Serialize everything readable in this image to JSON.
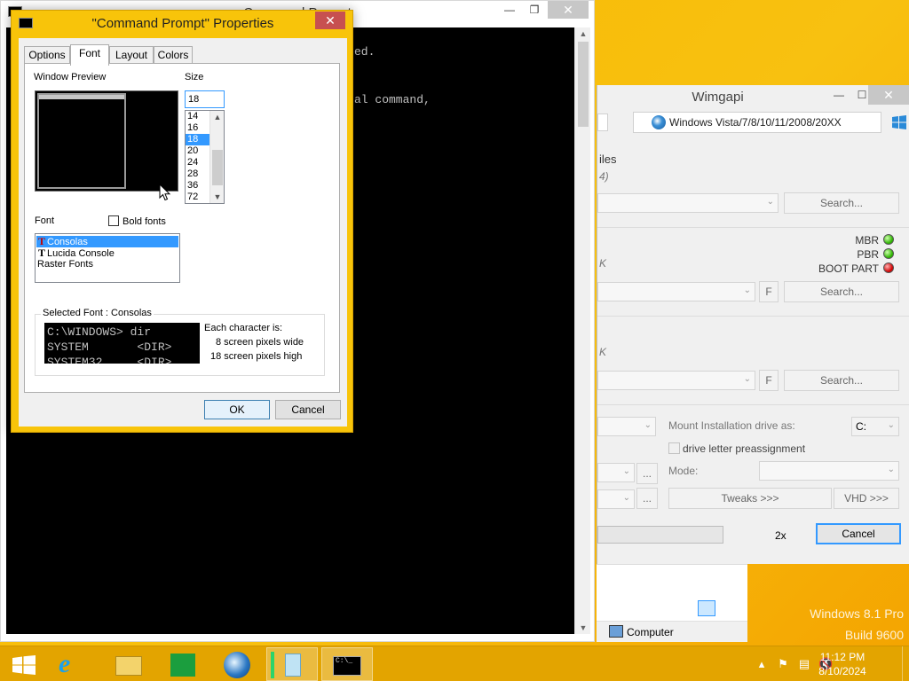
{
  "desktop": {
    "watermark_line1": "Windows 8.1 Pro",
    "watermark_line2": "Build 9600"
  },
  "console": {
    "title": "Command Prompt",
    "minimize": "—",
    "maximize": "❐",
    "close": "✕",
    "lines": [
      "ed.",
      "al command,"
    ]
  },
  "dialog": {
    "title": "\"Command Prompt\" Properties",
    "close": "✕",
    "tabs": [
      "Options",
      "Font",
      "Layout",
      "Colors"
    ],
    "active_tab": "Font",
    "window_preview_label": "Window Preview",
    "size_label": "Size",
    "size_value": "18",
    "sizes": [
      "14",
      "16",
      "18",
      "20",
      "24",
      "28",
      "36",
      "72"
    ],
    "selected_size": "18",
    "font_label": "Font",
    "bold_fonts_label": "Bold fonts",
    "bold_checked": false,
    "fonts": [
      {
        "name": "Consolas",
        "truetype": true,
        "selected": true
      },
      {
        "name": "Lucida Console",
        "truetype": true,
        "selected": false
      },
      {
        "name": "Raster Fonts",
        "truetype": false,
        "selected": false
      }
    ],
    "selected_font_label": "Selected Font : Consolas",
    "sample_lines": [
      "C:\\WINDOWS> dir",
      "SYSTEM       <DIR>",
      "SYSTEM32     <DIR>"
    ],
    "char_info_title": "Each character is:",
    "char_width": "8 screen pixels wide",
    "char_height": "18 screen pixels high",
    "ok": "OK",
    "cancel": "Cancel"
  },
  "wimgapi": {
    "title": "Wimgapi",
    "minimize": "—",
    "maximize": "☐",
    "close": "✕",
    "os_option": "Windows Vista/7/8/10/11/2008/20XX",
    "files_label": "iles",
    "files_sub": "4)",
    "search1": "Search...",
    "mbr": "MBR",
    "pbr": "PBR",
    "boot_part": "BOOT PART",
    "k_label_1": "K",
    "f_button_1": "F",
    "search2": "Search...",
    "k_label_2": "K",
    "f_button_2": "F",
    "search3": "Search...",
    "mount_label": "Mount Installation drive as:",
    "drive_value": "C:",
    "preassign_label": "drive letter preassignment",
    "mode_label": "Mode:",
    "ellipsis1": "...",
    "ellipsis2": "...",
    "tweaks": "Tweaks >>>",
    "vhd": "VHD >>>",
    "multiplier": "2x",
    "cancel": "Cancel",
    "led_colors": {
      "mbr": "green",
      "pbr": "green",
      "boot_part": "red"
    }
  },
  "explorer": {
    "computer": "Computer"
  },
  "taskbar": {
    "time": "11:12 PM",
    "date": "8/10/2024",
    "items": [
      "start-icon",
      "internet-explorer-icon",
      "file-explorer-icon",
      "store-icon",
      "wintoolkit-icon",
      "wimgapi-icon",
      "command-prompt-icon"
    ]
  }
}
